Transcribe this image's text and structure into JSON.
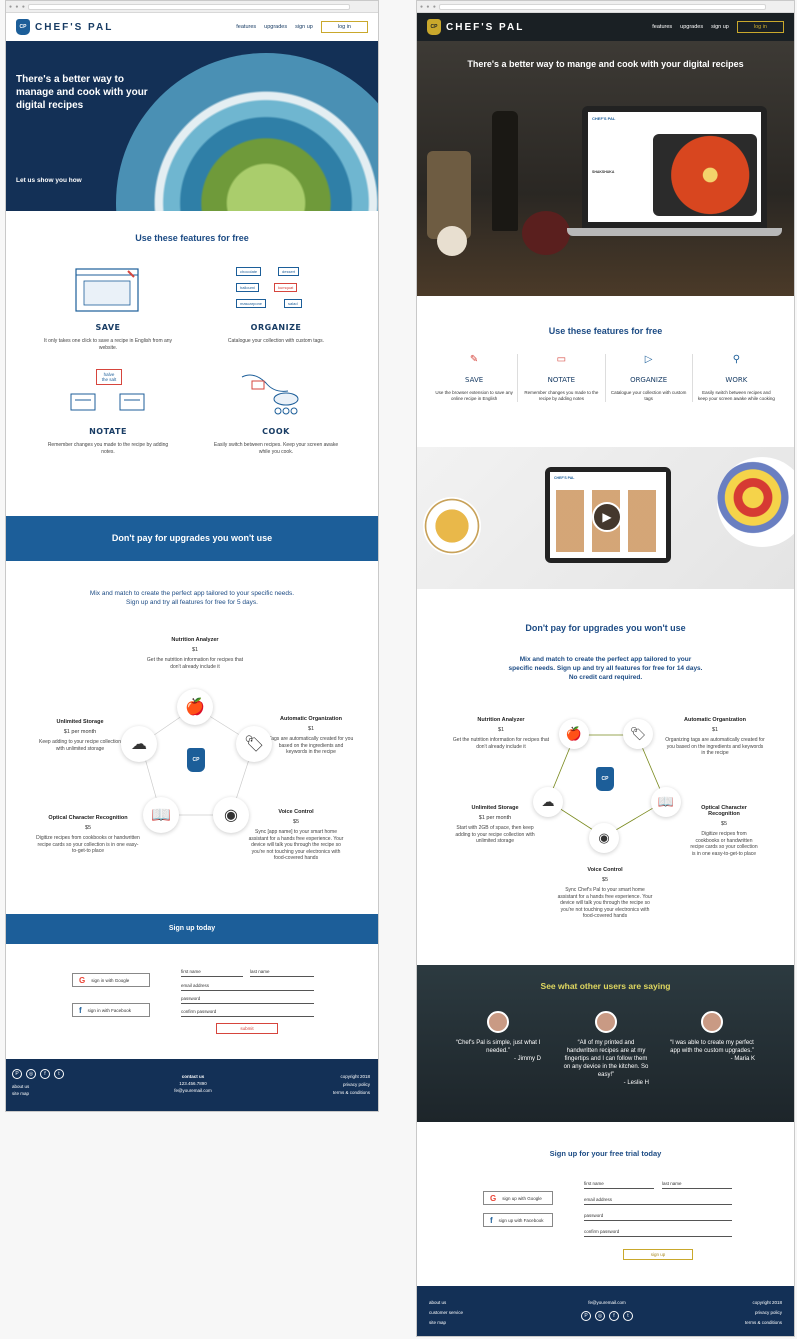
{
  "brand": {
    "name": "CHEF'S PAL",
    "mark": "CP"
  },
  "nav": {
    "features": "features",
    "upgrades": "upgrades",
    "signup": "sign up",
    "login": "log in"
  },
  "mockA": {
    "hero": {
      "headline": "There's a better way to manage and cook with your digital recipes",
      "cta": "Let us show you how"
    },
    "features_title": "Use these features for free",
    "features": [
      {
        "name": "SAVE",
        "desc": "It only takes one click to save a recipe in English from any website."
      },
      {
        "name": "ORGANIZE",
        "desc": "Catalogue your collection with custom tags."
      },
      {
        "name": "NOTATE",
        "desc": "Remember changes you made to the recipe by adding notes."
      },
      {
        "name": "COOK",
        "desc": "Easily switch between recipes. Keep your screen awake while you cook."
      }
    ],
    "tags": [
      "chocolate",
      "dessert",
      "halloumi",
      "kumquat",
      "mascarpone",
      "salad"
    ],
    "note_bubble": "halve the salt",
    "upgrades_band": "Don't pay for upgrades you won't use",
    "upgrades_intro": "Mix and match to create the perfect app tailored to your specific needs. Sign up and try all features for free for 5 days.",
    "upgrades": [
      {
        "name": "Nutrition Analyzer",
        "price": "$1",
        "desc": "Get the nutrition information for recipes that don't already include it"
      },
      {
        "name": "Unlimited Storage",
        "price": "$1 per month",
        "desc": "Keep adding to your recipe collection with unlimited storage"
      },
      {
        "name": "Automatic Organization",
        "price": "$1",
        "desc": "Tags are automatically created for you based on the ingredients and keywords in the recipe"
      },
      {
        "name": "Optical Character Recognition",
        "price": "$5",
        "desc": "Digitize recipes from cookbooks or handwritten recipe cards so your collection is in one easy-to-get-to place"
      },
      {
        "name": "Voice Control",
        "price": "$5",
        "desc": "Sync [app name] to your smart home assistant for a hands free experience. Your device will talk you through the recipe so you're not touching your electronics with food-covered hands"
      }
    ],
    "signup_band": "Sign up today",
    "signup": {
      "google": "sign in with Google",
      "facebook": "sign in with Facebook",
      "first": "first name",
      "last": "last name",
      "email": "email address",
      "password": "password",
      "confirm": "confirm password",
      "submit": "submit"
    },
    "footer": {
      "about": "about us",
      "sitemap": "site map",
      "contact": "contact us",
      "phone": "123.456.7890",
      "email": "fe@youremail.com",
      "copyright": "copyright 2018",
      "privacy": "privacy policy",
      "terms": "terms & conditions"
    }
  },
  "mockB": {
    "hero_headline": "There's a better way to mange and cook with your digital recipes",
    "screen_title": "SHAKSHUKA",
    "features_title": "Use these features for free",
    "features": [
      {
        "name": "SAVE",
        "desc": "Use the browser extension to save any online recipe in English"
      },
      {
        "name": "NOTATE",
        "desc": "Remember changes you made to the recipe by adding notes"
      },
      {
        "name": "ORGANIZE",
        "desc": "Catalogue your collection with custom tags"
      },
      {
        "name": "WORK",
        "desc": "Easily switch between recipes and keep your screen awake while cooking"
      }
    ],
    "upgrades_title": "Don't pay for upgrades you won't use",
    "upgrades_intro": "Mix and match to create the perfect app tailored to your specific needs. Sign up and try all features for free for 14 days. No credit card required.",
    "upgrades": [
      {
        "name": "Nutrition Analyzer",
        "price": "$1",
        "desc": "Get the nutrition information for recipes that don't already include it"
      },
      {
        "name": "Automatic Organization",
        "price": "$1",
        "desc": "Organizing tags are automatically created for you based on the ingredients and keywords in the recipe"
      },
      {
        "name": "Unlimited Storage",
        "price": "$1 per month",
        "desc": "Start with 2GB of space, then keep adding to your recipe collection with unlimited storage"
      },
      {
        "name": "Optical Character Recognition",
        "price": "$5",
        "desc": "Digitize recipes from cookbooks or handwritten recipe cards so your collection is in one easy-to-get-to place"
      },
      {
        "name": "Voice Control",
        "price": "$5",
        "desc": "Sync Chef's Pal to your smart home assistant for a hands free experience. Your device will talk you through the recipe so you're not touching your electronics with food-covered hands"
      }
    ],
    "reviews_title": "See what other users are saying",
    "reviews": [
      {
        "quote": "“Chef's Pal is simple, just what I needed.”",
        "author": "- Jimmy D"
      },
      {
        "quote": "“All of my printed and handwritten recipes are at my fingertips and I can follow them on any device in the kitchen. So easy!”",
        "author": "- Leslie H"
      },
      {
        "quote": "“I was able to create my perfect app with the custom upgrades.”",
        "author": "- Maria K"
      }
    ],
    "signup_title": "Sign up for your free trial today",
    "signup": {
      "google": "sign up with Google",
      "facebook": "sign up with Facebook",
      "first": "first name",
      "last": "last name",
      "email": "email address",
      "password": "password",
      "confirm": "confirm password",
      "submit": "sign up"
    },
    "footer": {
      "about": "about us",
      "service": "customer service",
      "sitemap": "site map",
      "email": "fe@youremail.com",
      "copyright": "copyright 2018",
      "privacy": "privacy policy",
      "terms": "terms & conditions"
    }
  },
  "colors": {
    "navy": "#133056",
    "blue": "#1c5e99",
    "gold": "#c9a82c",
    "red": "#d6453d"
  }
}
